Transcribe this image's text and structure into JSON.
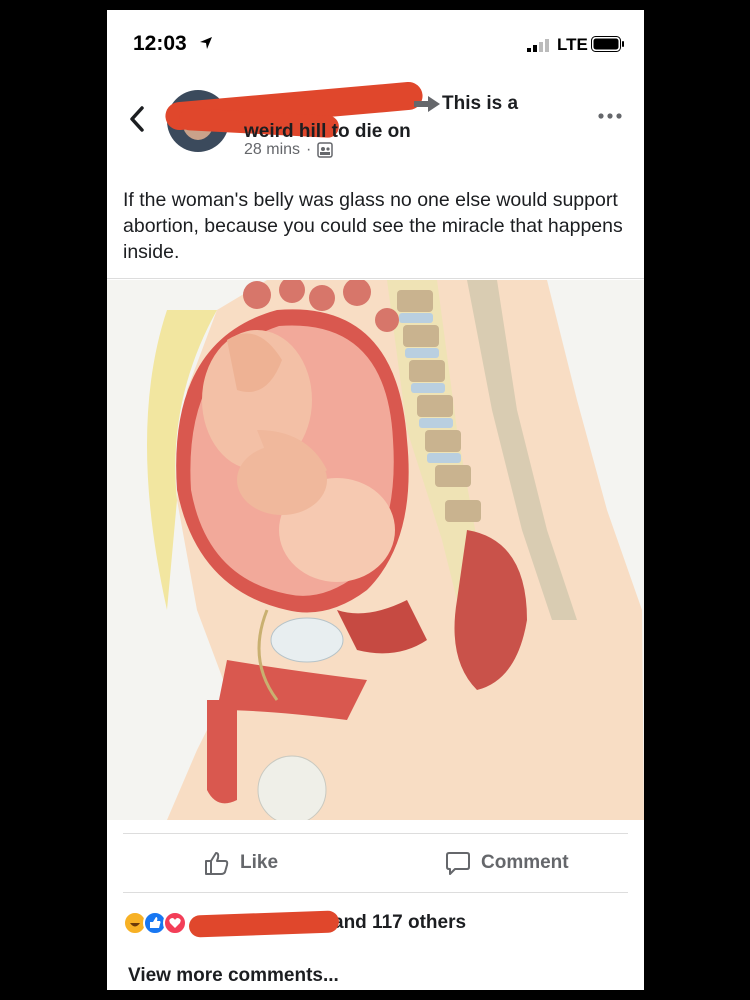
{
  "status_bar": {
    "time": "12:03",
    "network": "LTE"
  },
  "post": {
    "header_line1": "This is a",
    "header_line2": "weird hill to die on",
    "time_ago": "28 mins",
    "separator": "·",
    "body": "If the woman's belly was glass no one else would support abortion, because you could see the miracle that happens inside."
  },
  "actions": {
    "like_label": "Like",
    "comment_label": "Comment"
  },
  "reactions": {
    "summary": "and 117 others"
  },
  "comments": {
    "view_more": "View more comments..."
  },
  "colors": {
    "facebook_blue": "#1877f2",
    "redaction": "#e0472c",
    "love_red": "#f33e58",
    "haha_yellow": "#f7b125"
  },
  "icons": [
    "location-arrow-icon",
    "signal-icon",
    "battery-icon",
    "back-chevron-icon",
    "more-dots-icon",
    "public-icon",
    "like-icon",
    "comment-icon"
  ]
}
